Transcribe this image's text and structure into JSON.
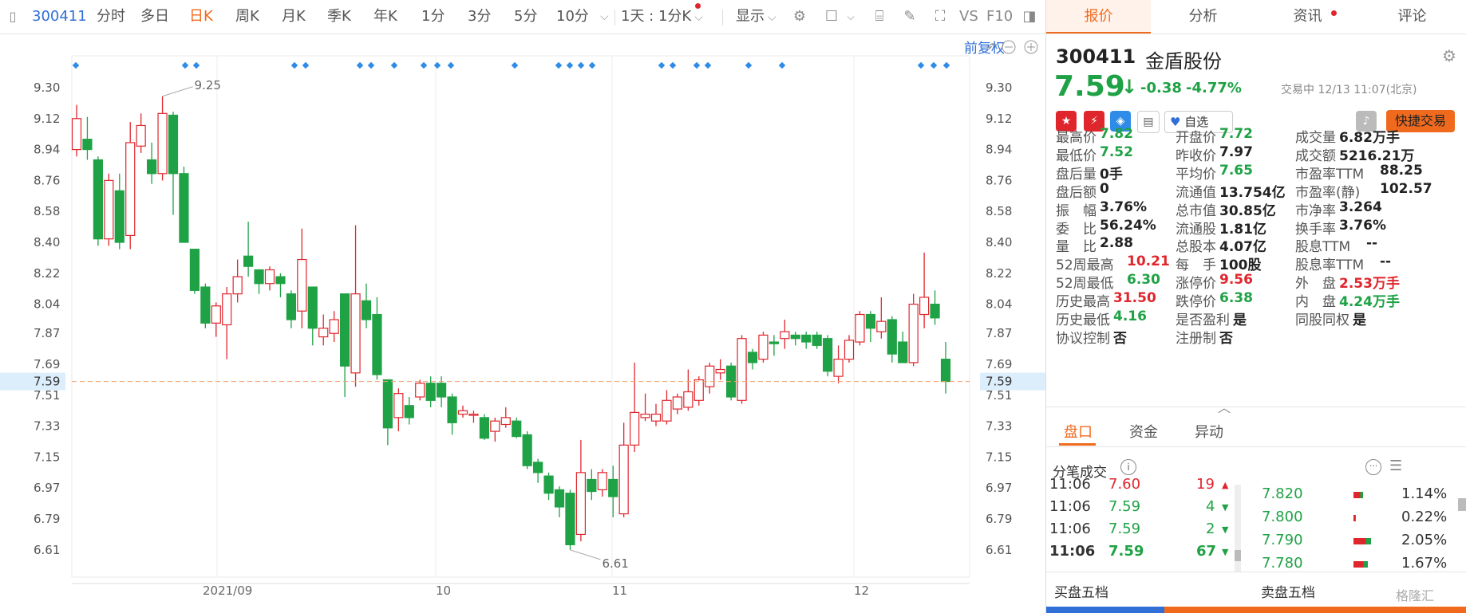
{
  "toolbar": {
    "code": "300411",
    "periods": [
      "分时",
      "多日",
      "日K",
      "周K",
      "月K",
      "季K",
      "年K",
      "1分",
      "3分",
      "5分",
      "10分"
    ],
    "active_period": "日K",
    "range_select": "1天 : 1分K",
    "display_label": "显示",
    "vs_label": "VS",
    "f10_label": "F10"
  },
  "chart": {
    "adjust_label": "前复权",
    "y_ticks": [
      "9.30",
      "9.12",
      "8.94",
      "8.76",
      "8.58",
      "8.40",
      "8.22",
      "8.04",
      "7.87",
      "7.69",
      "7.51",
      "7.33",
      "7.15",
      "6.97",
      "6.79",
      "6.61"
    ],
    "current_price_label": "7.59",
    "max_label": "9.25",
    "min_label": "6.61",
    "x_labels": [
      "2021/09",
      "10",
      "11",
      "12"
    ]
  },
  "chart_data": {
    "type": "candlestick",
    "ylim": [
      6.52,
      9.36
    ],
    "current_price": 7.59,
    "high": 9.25,
    "low": 6.61,
    "candles": [
      [
        8.94,
        9.12,
        9.2,
        8.9
      ],
      [
        9.0,
        8.94,
        9.13,
        8.88
      ],
      [
        8.88,
        8.42,
        8.9,
        8.38
      ],
      [
        8.42,
        8.76,
        8.8,
        8.38
      ],
      [
        8.7,
        8.4,
        8.8,
        8.36
      ],
      [
        8.44,
        8.98,
        9.1,
        8.36
      ],
      [
        8.96,
        9.08,
        9.15,
        8.92
      ],
      [
        8.88,
        8.8,
        8.98,
        8.74
      ],
      [
        8.8,
        9.15,
        9.25,
        8.76
      ],
      [
        9.14,
        8.8,
        9.16,
        8.56
      ],
      [
        8.8,
        8.4,
        8.84,
        8.4
      ],
      [
        8.36,
        8.12,
        8.36,
        8.1
      ],
      [
        8.14,
        7.93,
        8.16,
        7.9
      ],
      [
        7.93,
        8.03,
        8.05,
        7.85
      ],
      [
        7.92,
        8.1,
        8.14,
        7.72
      ],
      [
        8.1,
        8.2,
        8.3,
        8.05
      ],
      [
        8.32,
        8.26,
        8.52,
        8.2
      ],
      [
        8.24,
        8.16,
        8.24,
        8.1
      ],
      [
        8.16,
        8.24,
        8.26,
        8.12
      ],
      [
        8.2,
        8.16,
        8.22,
        8.08
      ],
      [
        8.1,
        7.95,
        8.12,
        7.9
      ],
      [
        8.0,
        8.3,
        8.48,
        7.9
      ],
      [
        8.14,
        7.9,
        8.14,
        7.8
      ],
      [
        7.85,
        7.9,
        7.98,
        7.8
      ],
      [
        7.87,
        7.95,
        8.0,
        7.82
      ],
      [
        8.1,
        7.68,
        8.1,
        7.5
      ],
      [
        7.64,
        8.1,
        8.5,
        7.56
      ],
      [
        8.06,
        7.95,
        8.16,
        7.9
      ],
      [
        7.98,
        7.63,
        8.08,
        7.6
      ],
      [
        7.6,
        7.32,
        7.6,
        7.22
      ],
      [
        7.38,
        7.52,
        7.55,
        7.3
      ],
      [
        7.45,
        7.38,
        7.5,
        7.34
      ],
      [
        7.5,
        7.58,
        7.6,
        7.48
      ],
      [
        7.58,
        7.48,
        7.62,
        7.44
      ],
      [
        7.58,
        7.5,
        7.62,
        7.44
      ],
      [
        7.5,
        7.35,
        7.52,
        7.28
      ],
      [
        7.4,
        7.42,
        7.45,
        7.38
      ],
      [
        7.4,
        7.4,
        7.42,
        7.35
      ],
      [
        7.38,
        7.26,
        7.4,
        7.25
      ],
      [
        7.3,
        7.36,
        7.38,
        7.24
      ],
      [
        7.34,
        7.38,
        7.44,
        7.32
      ],
      [
        7.36,
        7.27,
        7.38,
        7.26
      ],
      [
        7.28,
        7.1,
        7.3,
        7.08
      ],
      [
        7.12,
        7.06,
        7.14,
        7.0
      ],
      [
        7.04,
        6.94,
        7.06,
        6.9
      ],
      [
        6.96,
        6.86,
        6.98,
        6.8
      ],
      [
        6.94,
        6.64,
        6.96,
        6.61
      ],
      [
        6.7,
        7.06,
        7.25,
        6.66
      ],
      [
        7.02,
        6.95,
        7.08,
        6.9
      ],
      [
        6.96,
        7.06,
        7.08,
        6.92
      ],
      [
        7.02,
        6.92,
        7.1,
        6.8
      ],
      [
        6.82,
        7.22,
        7.35,
        6.8
      ],
      [
        7.22,
        7.41,
        7.7,
        7.18
      ],
      [
        7.38,
        7.4,
        7.52,
        7.36
      ],
      [
        7.36,
        7.4,
        7.46,
        7.33
      ],
      [
        7.36,
        7.48,
        7.54,
        7.34
      ],
      [
        7.43,
        7.5,
        7.52,
        7.4
      ],
      [
        7.44,
        7.53,
        7.66,
        7.42
      ],
      [
        7.48,
        7.6,
        7.62,
        7.45
      ],
      [
        7.56,
        7.68,
        7.7,
        7.52
      ],
      [
        7.64,
        7.66,
        7.72,
        7.6
      ],
      [
        7.68,
        7.5,
        7.7,
        7.48
      ],
      [
        7.48,
        7.84,
        7.86,
        7.46
      ],
      [
        7.76,
        7.7,
        7.78,
        7.66
      ],
      [
        7.72,
        7.86,
        7.88,
        7.7
      ],
      [
        7.82,
        7.81,
        7.86,
        7.74
      ],
      [
        7.84,
        7.88,
        7.95,
        7.78
      ],
      [
        7.86,
        7.84,
        7.88,
        7.8
      ],
      [
        7.86,
        7.82,
        7.88,
        7.78
      ],
      [
        7.86,
        7.8,
        7.88,
        7.78
      ],
      [
        7.84,
        7.65,
        7.86,
        7.62
      ],
      [
        7.62,
        7.72,
        7.8,
        7.58
      ],
      [
        7.72,
        7.83,
        7.86,
        7.7
      ],
      [
        7.82,
        7.98,
        8.0,
        7.8
      ],
      [
        7.98,
        7.9,
        8.0,
        7.82
      ],
      [
        7.88,
        7.94,
        8.08,
        7.84
      ],
      [
        7.95,
        7.75,
        7.97,
        7.7
      ],
      [
        7.82,
        7.7,
        7.88,
        7.7
      ],
      [
        7.7,
        8.04,
        8.1,
        7.68
      ],
      [
        7.98,
        8.08,
        8.34,
        7.9
      ],
      [
        8.04,
        7.96,
        8.12,
        7.92
      ],
      [
        7.72,
        7.59,
        7.82,
        7.52
      ]
    ],
    "markers_note": "blue diamond markers along top of chart"
  },
  "panel": {
    "tabs": [
      "报价",
      "分析",
      "资讯",
      "评论"
    ],
    "stock_code": "300411",
    "stock_name": "金盾股份",
    "price": "7.59",
    "arrow": "↓",
    "change": "-0.38",
    "change_pct": "-4.77%",
    "status_time": "交易中 12/13 11:07(北京)",
    "watch_label": "自选",
    "quick_trade_label": "快捷交易",
    "fields": [
      {
        "l": "最高价",
        "v": "7.82",
        "c": "down"
      },
      {
        "l": "开盘价",
        "v": "7.72",
        "c": "down"
      },
      {
        "l": "成交量",
        "v": "6.82万手",
        "c": ""
      },
      {
        "l": "最低价",
        "v": "7.52",
        "c": "down"
      },
      {
        "l": "昨收价",
        "v": "7.97",
        "c": ""
      },
      {
        "l": "成交额",
        "v": "5216.21万",
        "c": ""
      },
      {
        "l": "盘后量",
        "v": "0手",
        "c": ""
      },
      {
        "l": "平均价",
        "v": "7.65",
        "c": "down"
      },
      {
        "l": "市盈率TTM",
        "v": "88.25",
        "c": ""
      },
      {
        "l": "盘后额",
        "v": "0",
        "c": ""
      },
      {
        "l": "流通值",
        "v": "13.754亿",
        "c": ""
      },
      {
        "l": "市盈率(静)",
        "v": "102.57",
        "c": ""
      },
      {
        "l": "振　幅",
        "v": "3.76%",
        "c": ""
      },
      {
        "l": "总市值",
        "v": "30.85亿",
        "c": ""
      },
      {
        "l": "市净率",
        "v": "3.264",
        "c": ""
      },
      {
        "l": "委　比",
        "v": "56.24%",
        "c": ""
      },
      {
        "l": "流通股",
        "v": "1.81亿",
        "c": ""
      },
      {
        "l": "换手率",
        "v": "3.76%",
        "c": ""
      },
      {
        "l": "量　比",
        "v": "2.88",
        "c": ""
      },
      {
        "l": "总股本",
        "v": "4.07亿",
        "c": ""
      },
      {
        "l": "股息TTM",
        "v": "--",
        "c": ""
      },
      {
        "l": "52周最高",
        "v": "10.21",
        "c": "up"
      },
      {
        "l": "每　手",
        "v": "100股",
        "c": ""
      },
      {
        "l": "股息率TTM",
        "v": "--",
        "c": ""
      },
      {
        "l": "52周最低",
        "v": "6.30",
        "c": "down"
      },
      {
        "l": "涨停价",
        "v": "9.56",
        "c": "up"
      },
      {
        "l": "外　盘",
        "v": "2.53万手",
        "c": "up"
      },
      {
        "l": "历史最高",
        "v": "31.50",
        "c": "up"
      },
      {
        "l": "跌停价",
        "v": "6.38",
        "c": "down"
      },
      {
        "l": "内　盘",
        "v": "4.24万手",
        "c": "down"
      },
      {
        "l": "历史最低",
        "v": "4.16",
        "c": "down"
      },
      {
        "l": "是否盈利",
        "v": "是",
        "c": ""
      },
      {
        "l": "同股同权",
        "v": "是",
        "c": ""
      },
      {
        "l": "协议控制",
        "v": "否",
        "c": ""
      },
      {
        "l": "注册制",
        "v": "否",
        "c": ""
      },
      {
        "l": "",
        "v": "",
        "c": ""
      }
    ],
    "sub_tabs": [
      "盘口",
      "资金",
      "异动"
    ],
    "ticks_title": "分笔成交",
    "ticks": [
      {
        "time": "11:06",
        "price": "7.60",
        "vol": "19",
        "dir": "up"
      },
      {
        "time": "11:06",
        "price": "7.59",
        "vol": "4",
        "dir": "down"
      },
      {
        "time": "11:06",
        "price": "7.59",
        "vol": "2",
        "dir": "down"
      },
      {
        "time": "11:06",
        "price": "7.59",
        "vol": "67",
        "dir": "down"
      }
    ],
    "dist": [
      {
        "price": "7.820",
        "pct": "1.14%",
        "fill": 0.45
      },
      {
        "price": "7.800",
        "pct": "0.22%",
        "fill": 0.1
      },
      {
        "price": "7.790",
        "pct": "2.05%",
        "fill": 0.85
      },
      {
        "price": "7.780",
        "pct": "1.67%",
        "fill": 0.7
      }
    ],
    "buy5": "买盘五档",
    "sell5": "卖盘五档",
    "watermark": "格隆汇"
  },
  "colors": {
    "up": "#e0262d",
    "down": "#1fa245",
    "accent": "#f06a1d",
    "link": "#2f6fd6",
    "marker": "#2f8be8"
  }
}
